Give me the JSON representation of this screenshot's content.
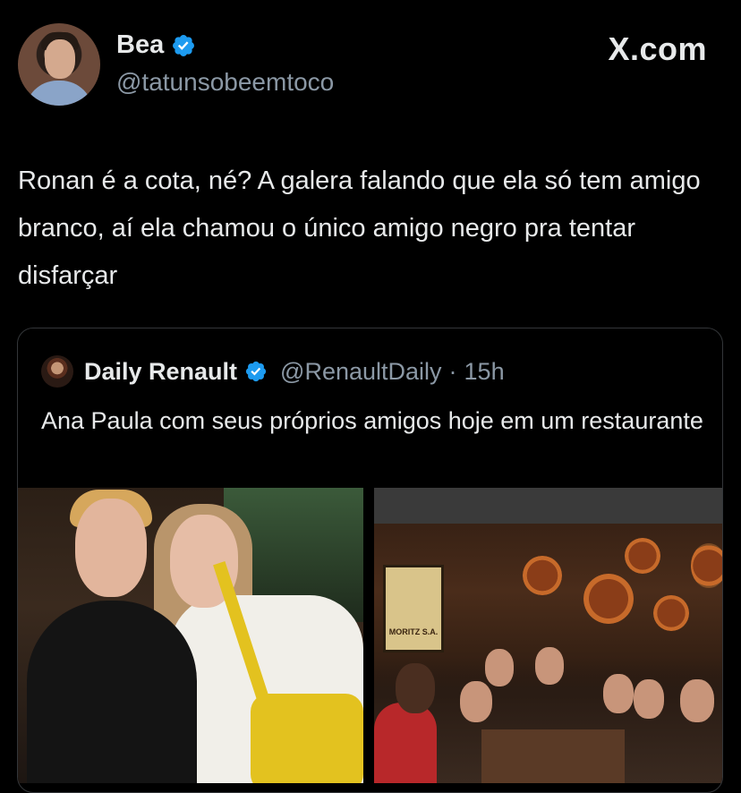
{
  "post": {
    "display_name": "Bea",
    "handle": "@tatunsobeemtoco",
    "verified_icon": "verified-badge-icon",
    "brand": "X.com",
    "text": "Ronan é a cota, né? A galera falando que ela só tem amigo branco, aí ela chamou o único amigo negro pra tentar disfarçar"
  },
  "quoted": {
    "display_name": "Daily Renault",
    "handle": "@RenaultDaily",
    "separator": "·",
    "time": "15h",
    "text": "Ana Paula com seus próprios amigos hoje em um restaurante",
    "photo_right_poster_text": "MORITZ S.A."
  },
  "colors": {
    "background": "#000000",
    "text_primary": "#e7e9ea",
    "text_secondary": "#8b98a5",
    "verified": "#1d9bf0",
    "border": "#333639"
  }
}
